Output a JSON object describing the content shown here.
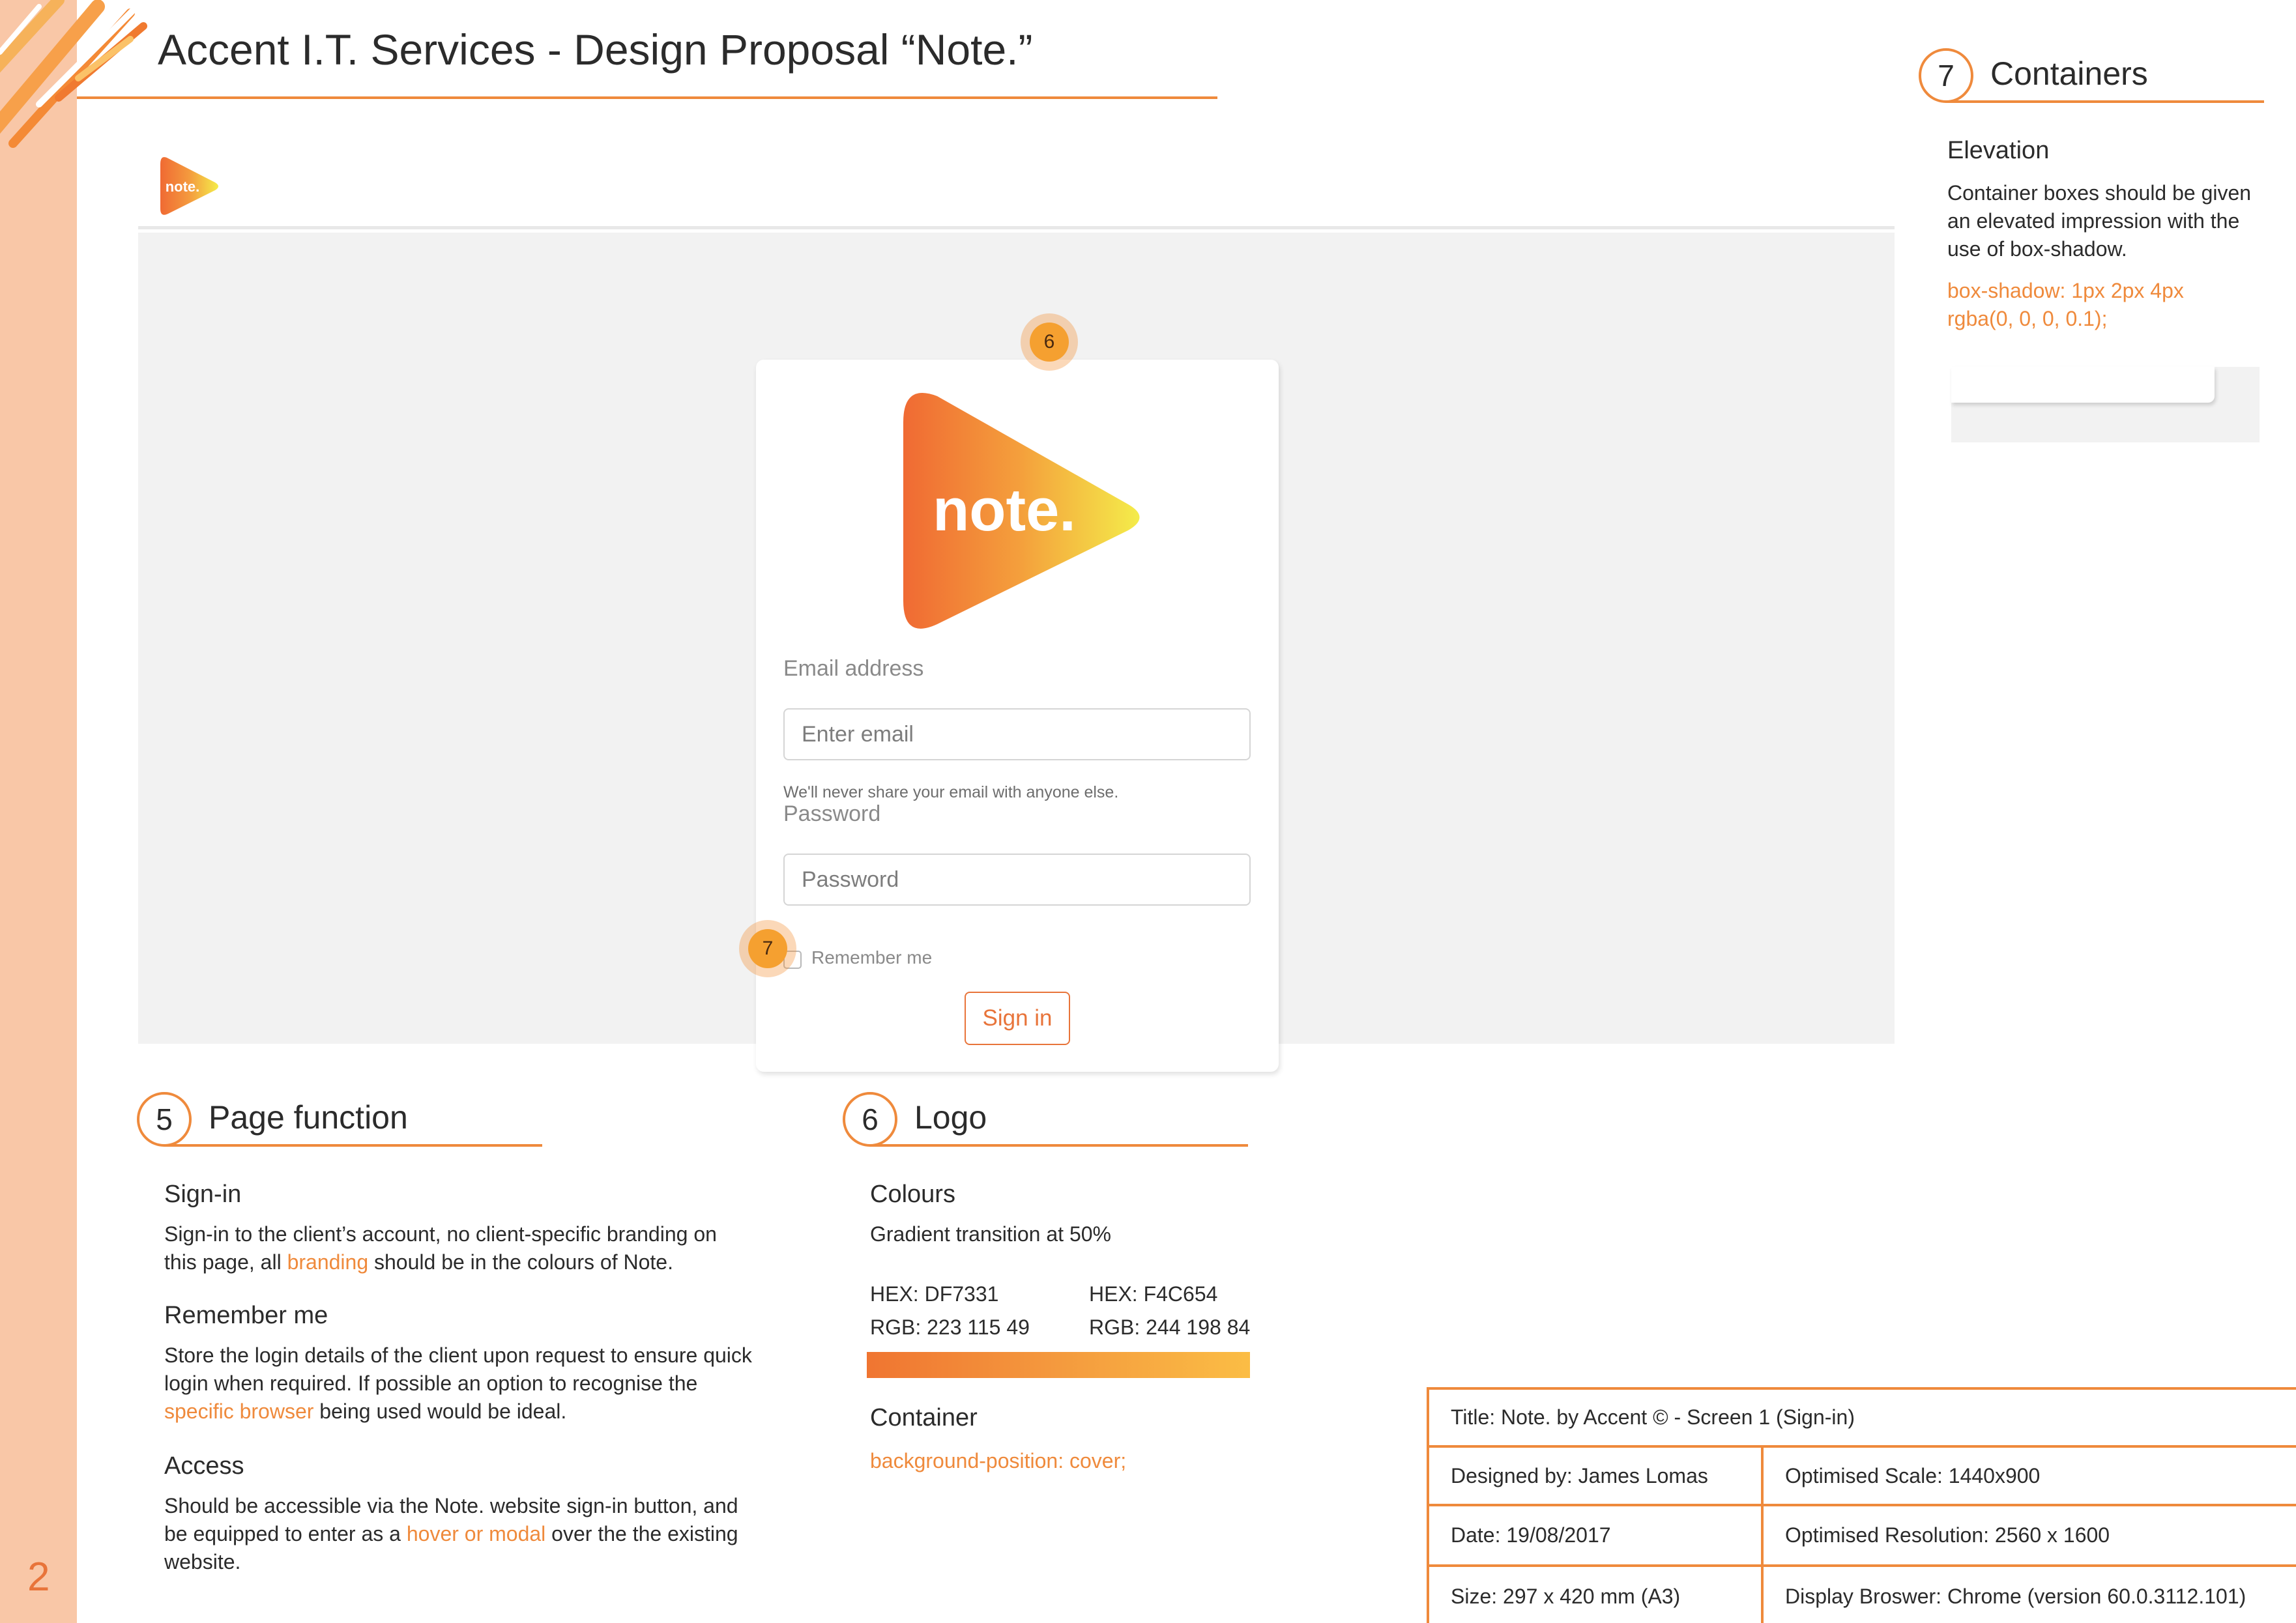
{
  "page": {
    "number": "2",
    "title": "Accent I.T. Services - Design Proposal “Note.”",
    "accent_color": "#EF8A3C"
  },
  "mockup": {
    "header_logo_text": "note.",
    "card_logo_text": "note.",
    "email": {
      "label": "Email address",
      "placeholder": "Enter email",
      "help": "We'll never share your email with anyone else."
    },
    "password": {
      "label": "Password",
      "placeholder": "Password"
    },
    "remember_label": "Remember me",
    "signin_label": "Sign in",
    "marker_logo": "6",
    "marker_container": "7"
  },
  "containers": {
    "number": "7",
    "title": "Containers",
    "elevation_heading": "Elevation",
    "elevation_text": [
      "Container boxes should be given",
      "an elevated impression with the",
      "use of box-shadow."
    ],
    "code_lines": [
      "box-shadow: 1px 2px 4px",
      "rgba(0, 0, 0, 0.1);"
    ]
  },
  "page_function": {
    "number": "5",
    "title": "Page function",
    "signin": {
      "heading": "Sign-in",
      "line1": "Sign-in to the client’s account, no client-specific branding on",
      "line2_pre": "this page, all ",
      "line2_link": "branding",
      "line2_post": " should be in the colours of Note."
    },
    "remember": {
      "heading": "Remember me",
      "line1": "Store the login details of the client upon request to ensure quick",
      "line2": "login when required. If possible an option to recognise the",
      "line3_link": "specific browser",
      "line3_post": " being used would be ideal."
    },
    "access": {
      "heading": "Access",
      "line1": "Should be accessible via the Note. website sign-in button, and",
      "line2_pre": "be equipped to enter as a ",
      "line2_link": "hover or modal",
      "line2_post": " over the the existing",
      "line3": "website."
    }
  },
  "logo_section": {
    "number": "6",
    "title": "Logo",
    "colours_heading": "Colours",
    "gradient_note": "Gradient transition at 50%",
    "color1_hex": "HEX: DF7331",
    "color1_rgb": "RGB: 223 115 49",
    "color2_hex": "HEX: F4C654",
    "color2_rgb": "RGB: 244 198 84",
    "container_heading": "Container",
    "container_code": "background-position: cover;"
  },
  "info_table": {
    "title": "Title: Note. by Accent © - Screen 1 (Sign-in)",
    "designer": "Designed by: James Lomas",
    "scale": "Optimised Scale: 1440x900",
    "date": "Date: 19/08/2017",
    "resolution": "Optimised Resolution: 2560 x 1600",
    "size": "Size: 297 x 420 mm (A3)",
    "browser": "Display Broswer: Chrome (version 60.0.3112.101)"
  }
}
